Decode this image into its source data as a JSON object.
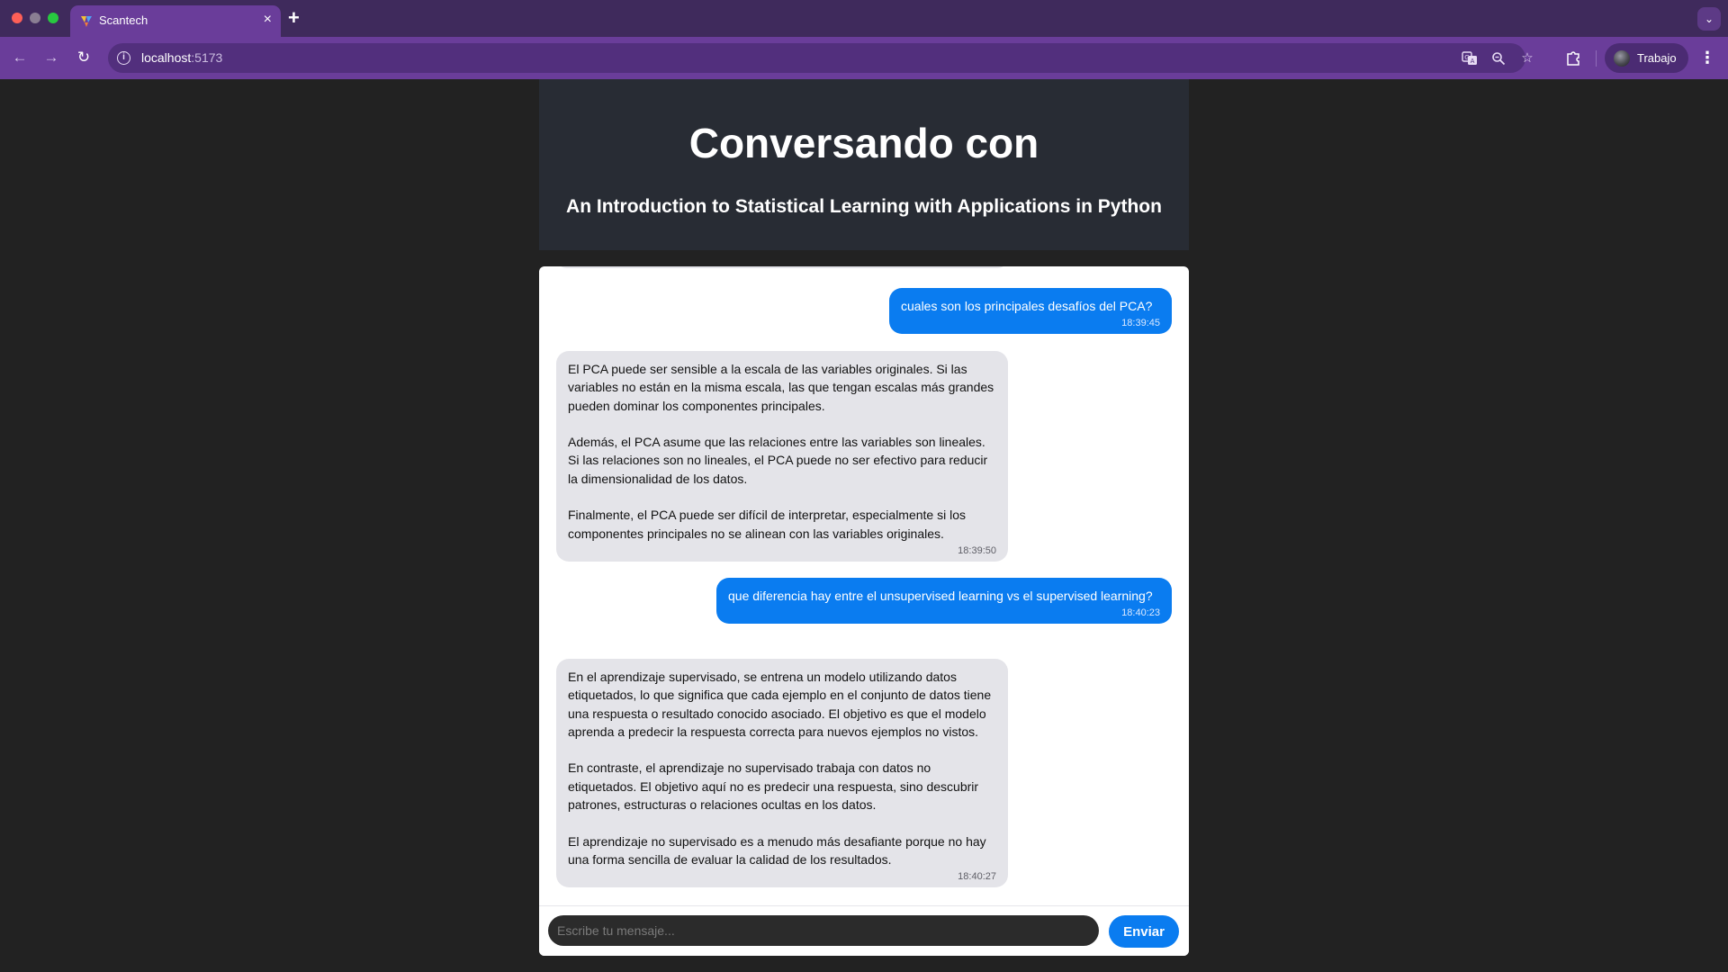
{
  "browser": {
    "tab_title": "Scantech",
    "tab_close": "×",
    "new_tab": "+",
    "tab_search": "⌄",
    "url_host": "localhost",
    "url_port": ":5173",
    "profile_label": "Trabajo",
    "icons": [
      "back-arrow-icon",
      "forward-arrow-icon",
      "reload-icon",
      "site-info-icon",
      "translate-icon",
      "zoom-icon",
      "bookmark-star-icon",
      "extensions-icon",
      "more-menu-icon"
    ]
  },
  "header": {
    "title": "Conversando con",
    "subtitle": "An Introduction to Statistical Learning with Applications in Python"
  },
  "messages": [
    {
      "role": "user",
      "text": "cuales son los principales desafíos del PCA?",
      "time": "18:39:45"
    },
    {
      "role": "bot",
      "text": "El PCA puede ser sensible a la escala de las variables originales. Si las variables no están en la misma escala, las que tengan escalas más grandes pueden dominar los componentes principales.\n\n Además, el PCA asume que las relaciones entre las variables son lineales. Si las relaciones son no lineales, el PCA puede no ser efectivo para reducir la dimensionalidad de los datos.\n\nFinalmente, el PCA puede ser difícil de interpretar, especialmente si los componentes principales no se alinean con las variables originales.",
      "time": "18:39:50"
    },
    {
      "role": "user",
      "text": "que diferencia hay entre el unsupervised learning vs el supervised learning?",
      "time": "18:40:23"
    },
    {
      "role": "bot",
      "text": "En el aprendizaje supervisado, se entrena un modelo utilizando datos etiquetados, lo que significa que cada ejemplo en el conjunto de datos tiene una respuesta o resultado conocido asociado. El objetivo es que el modelo aprenda a predecir la respuesta correcta para nuevos ejemplos no vistos.\n\n En contraste, el aprendizaje no supervisado trabaja con datos no etiquetados. El objetivo aquí no es predecir una respuesta, sino descubrir patrones, estructuras o relaciones ocultas en los datos.\n\nEl aprendizaje no supervisado es a menudo más desafiante porque no hay una forma sencilla de evaluar la calidad de los resultados.",
      "time": "18:40:27"
    }
  ],
  "composer": {
    "placeholder": "Escribe tu mensaje...",
    "send_label": "Enviar"
  },
  "colors": {
    "browser_tabbar": "#3f2a5c",
    "browser_toolbar": "#6a3d9a",
    "page_background": "#222222",
    "header_background": "#282c34",
    "user_bubble": "#0a7cf0",
    "bot_bubble": "#e4e4e9",
    "send_button": "#0a7cf0"
  }
}
